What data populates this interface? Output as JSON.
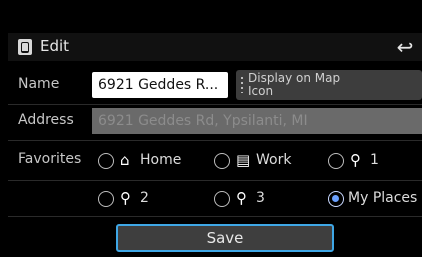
{
  "header": {
    "title": "Edit"
  },
  "form": {
    "name_label": "Name",
    "name_value": "6921 Geddes R...",
    "display_on_map_line1": "Display on Map",
    "display_on_map_line2": "Icon",
    "address_label": "Address",
    "address_value": "6921 Geddes Rd, Ypsilanti, MI",
    "favorites_label": "Favorites"
  },
  "favorites": [
    {
      "label": "Home",
      "icon": "home-icon",
      "selected": false
    },
    {
      "label": "Work",
      "icon": "building-icon",
      "selected": false
    },
    {
      "label": "1",
      "icon": "pin-icon",
      "selected": false
    },
    {
      "label": "2",
      "icon": "pin-icon",
      "selected": false
    },
    {
      "label": "3",
      "icon": "pin-icon",
      "selected": false
    },
    {
      "label": "My Places",
      "icon": "",
      "selected": true
    }
  ],
  "actions": {
    "save_label": "Save"
  },
  "colors": {
    "accent": "#3fa7e6",
    "selected_radio": "#6aa0ff"
  }
}
